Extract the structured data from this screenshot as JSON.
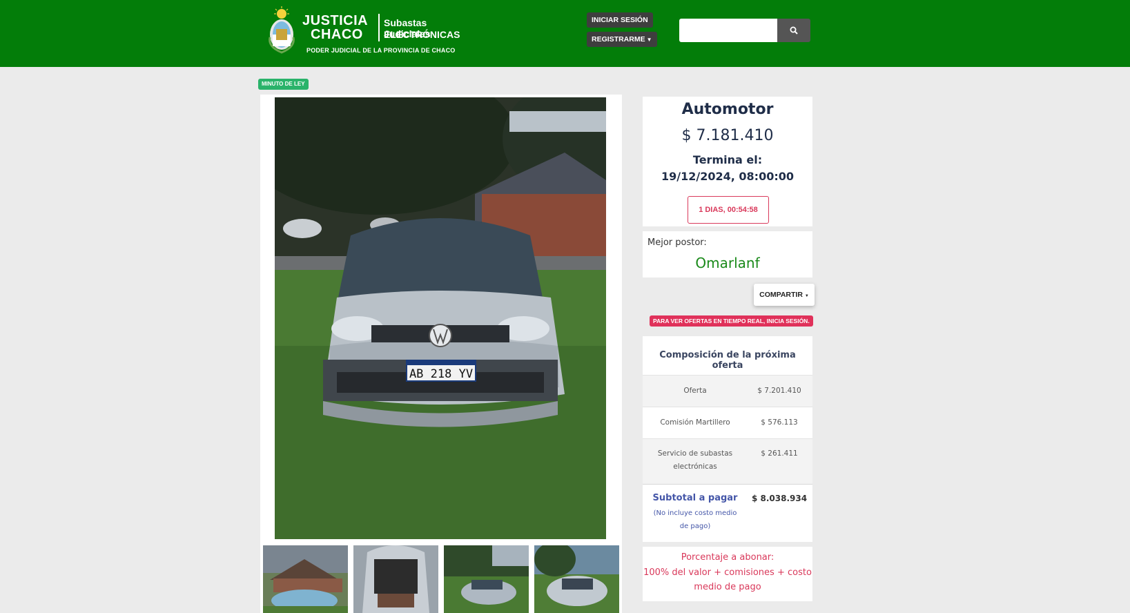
{
  "header": {
    "brand_justicia": "JUSTICIA",
    "brand_chaco": "CHACO",
    "brand_subastas": "Subastas Judiciales",
    "brand_electronicas": "ELECTRÓNICAS",
    "brand_poder": "PODER JUDICIAL DE LA PROVINCIA DE CHACO",
    "login_label": "INICIAR SESIÓN",
    "register_label": "REGISTRARME",
    "search_placeholder": "",
    "search_icon": "search-icon"
  },
  "badge": "MINUTO DE LEY",
  "auction": {
    "category": "Automotor",
    "price": "$ 7.181.410",
    "ends_label": "Termina el:",
    "ends_date": "19/12/2024, 08:00:00",
    "countdown": "1 DIAS, 00:54:58"
  },
  "bidder": {
    "label": "Mejor postor:",
    "name": "Omarlanf"
  },
  "share_label": "COMPARTIR",
  "realtime_notice": "PARA VER OFERTAS EN TIEMPO REAL, INICIA SESIÓN.",
  "composition": {
    "title": "Composición de la próxima oferta",
    "rows": [
      {
        "label": "Oferta",
        "value": "$ 7.201.410"
      },
      {
        "label": "Comisión Martillero",
        "value": "$ 576.113"
      },
      {
        "label1": "Servicio de subastas",
        "label2": "electrónicas",
        "value": "$ 261.411"
      }
    ],
    "subtotal_label": "Subtotal a pagar",
    "subtotal_note1": "(No incluye costo medio",
    "subtotal_note2": "de pago)",
    "subtotal_value": "$ 8.038.934"
  },
  "percentage": {
    "line1": "Porcentaje a abonar:",
    "line2": "100% del valor + comisiones + costo",
    "line3": "medio de pago"
  },
  "plate": "AB 218 YV",
  "colors": {
    "header_green": "#037d09",
    "bidder_green": "#1a8a1a",
    "alert_red": "#d9385a",
    "navy": "#1f2d48",
    "subtotal_blue": "#4456a8"
  }
}
